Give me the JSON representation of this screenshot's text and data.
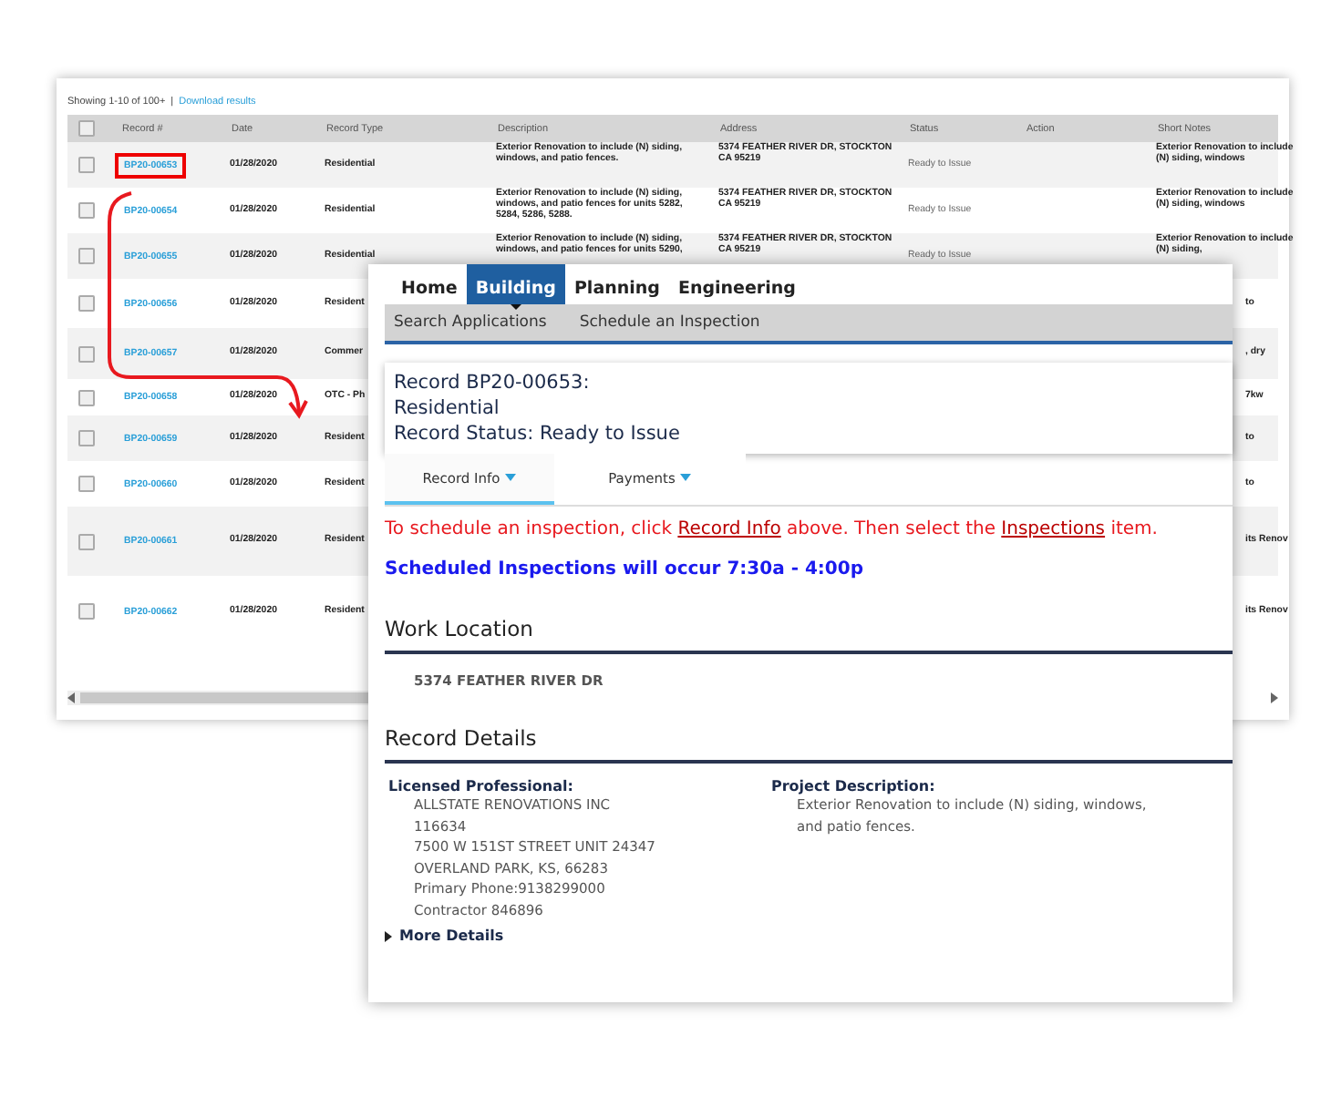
{
  "results_table": {
    "summary": "Showing 1-10 of 100+",
    "separator": "|",
    "download_link": "Download results",
    "select_all": {
      "checked": false
    },
    "columns": [
      "Record #",
      "Date",
      "Record Type",
      "Description",
      "Address",
      "Status",
      "Action",
      "Short Notes"
    ],
    "rows": [
      {
        "checked": false,
        "highlighted": true,
        "record": "BP20-00653",
        "date": "01/28/2020",
        "type": "Residential",
        "description": "Exterior Renovation to include (N) siding, windows, and patio fences.",
        "address": "5374 FEATHER RIVER DR, STOCKTON CA 95219",
        "status": "Ready to Issue",
        "notes": "Exterior Renovation to include (N) siding, windows"
      },
      {
        "checked": false,
        "highlighted": false,
        "record": "BP20-00654",
        "date": "01/28/2020",
        "type": "Residential",
        "description": "Exterior Renovation to include (N) siding, windows, and patio fences for units 5282, 5284, 5286, 5288.",
        "address": "5374 FEATHER RIVER DR, STOCKTON CA 95219",
        "status": "Ready to Issue",
        "notes": "Exterior Renovation to include (N) siding, windows"
      },
      {
        "checked": false,
        "highlighted": false,
        "record": "BP20-00655",
        "date": "01/28/2020",
        "type": "Residential",
        "description": "Exterior Renovation to include (N) siding, windows, and patio fences for units 5290,",
        "address": "5374 FEATHER RIVER DR, STOCKTON CA 95219",
        "status": "Ready to Issue",
        "notes": "Exterior Renovation to include (N) siding,"
      },
      {
        "checked": false,
        "highlighted": false,
        "record": "BP20-00656",
        "date": "01/28/2020",
        "type": "Resident",
        "notes_fragment": "to"
      },
      {
        "checked": false,
        "highlighted": false,
        "record": "BP20-00657",
        "date": "01/28/2020",
        "type": "Commer",
        "notes_fragment": ", dry"
      },
      {
        "checked": false,
        "highlighted": false,
        "record": "BP20-00658",
        "date": "01/28/2020",
        "type": "OTC - Ph",
        "notes_fragment": "7kw"
      },
      {
        "checked": false,
        "highlighted": false,
        "record": "BP20-00659",
        "date": "01/28/2020",
        "type": "Resident",
        "notes_fragment": "to"
      },
      {
        "checked": false,
        "highlighted": false,
        "record": "BP20-00660",
        "date": "01/28/2020",
        "type": "Resident",
        "notes_fragment": "to"
      },
      {
        "checked": false,
        "highlighted": false,
        "record": "BP20-00661",
        "date": "01/28/2020",
        "type": "Resident",
        "notes_fragment": "its Renov"
      },
      {
        "checked": false,
        "highlighted": false,
        "record": "BP20-00662",
        "date": "01/28/2020",
        "type": "Resident",
        "notes_fragment": "its Renov"
      }
    ]
  },
  "record_page": {
    "nav": [
      {
        "label": "Home",
        "selected": false
      },
      {
        "label": "Building",
        "selected": true
      },
      {
        "label": "Planning",
        "selected": false
      },
      {
        "label": "Engineering",
        "selected": false
      }
    ],
    "subnav": [
      "Search Applications",
      "Schedule an Inspection"
    ],
    "header_lines": [
      "Record BP20-00653:",
      "Residential",
      "Record Status: Ready to Issue"
    ],
    "tabs": [
      {
        "label": "Record Info",
        "selected": true
      },
      {
        "label": "Payments",
        "selected": false
      }
    ],
    "instruction": {
      "before": "To schedule an inspection, click ",
      "link1": "Record Info",
      "middle": " above. Then select the ",
      "link2": "Inspections",
      "after": " item."
    },
    "schedule_note": "Scheduled Inspections will occur 7:30a - 4:00p",
    "work_location": {
      "heading": "Work Location",
      "address": "5374 FEATHER RIVER DR"
    },
    "record_details": {
      "heading": "Record Details",
      "professional": {
        "label": "Licensed Professional:",
        "lines": [
          "ALLSTATE RENOVATIONS INC",
          "116634",
          "7500 W 151ST STREET UNIT 24347",
          "OVERLAND PARK, KS, 66283",
          "Primary Phone:9138299000",
          "Contractor 846896"
        ]
      },
      "project": {
        "label": "Project Description:",
        "text": "Exterior Renovation to include (N) siding, windows, and patio fences."
      },
      "more_details": "More Details"
    }
  }
}
